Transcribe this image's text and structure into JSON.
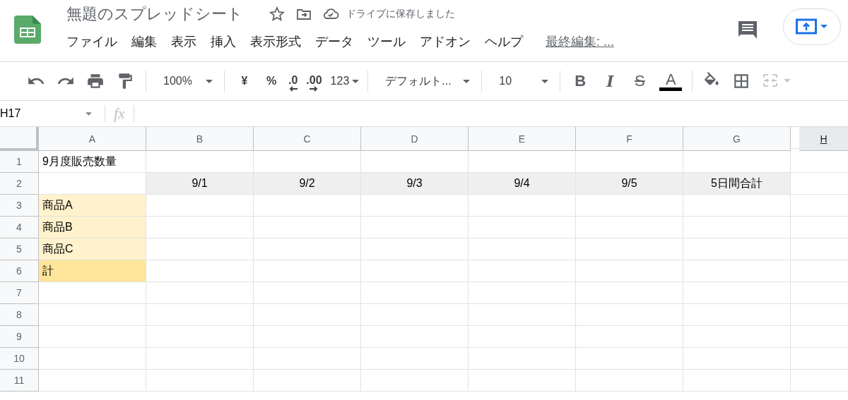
{
  "document": {
    "title": "無題のスプレッドシート",
    "save_status": "ドライブに保存しました",
    "starred": false
  },
  "menu": [
    "ファイル",
    "編集",
    "表示",
    "挿入",
    "表示形式",
    "データ",
    "ツール",
    "アドオン",
    "ヘルプ"
  ],
  "last_edit": "最終編集: ...",
  "toolbar": [
    {
      "kind": "undo"
    },
    {
      "kind": "redo"
    },
    {
      "kind": "print"
    },
    {
      "kind": "paint-format"
    },
    {
      "kind": "divider"
    },
    {
      "kind": "dropdown",
      "text": "100%"
    },
    {
      "kind": "divider"
    },
    {
      "kind": "text",
      "text": "¥"
    },
    {
      "kind": "text",
      "text": "%"
    },
    {
      "kind": "decimal-less",
      "text": ".0"
    },
    {
      "kind": "decimal-more",
      "text": ".00"
    },
    {
      "kind": "number-format",
      "text": "123"
    },
    {
      "kind": "divider"
    },
    {
      "kind": "font",
      "text": "デフォルト..."
    },
    {
      "kind": "divider"
    },
    {
      "kind": "dropdown",
      "text": "10"
    },
    {
      "kind": "divider"
    },
    {
      "kind": "bold",
      "text": "B"
    },
    {
      "kind": "italic",
      "text": "I"
    },
    {
      "kind": "strike",
      "text": "S"
    },
    {
      "kind": "text-color",
      "text": "A"
    },
    {
      "kind": "divider"
    },
    {
      "kind": "fill"
    },
    {
      "kind": "borders"
    },
    {
      "kind": "merge",
      "disabled": true
    }
  ],
  "name_box": "H17",
  "formula_label": "fx",
  "columns": [
    {
      "label": "A",
      "selected": false
    },
    {
      "label": "B",
      "selected": false
    },
    {
      "label": "C",
      "selected": false
    },
    {
      "label": "D",
      "selected": false
    },
    {
      "label": "E",
      "selected": false
    },
    {
      "label": "F",
      "selected": false
    },
    {
      "label": "G",
      "selected": false
    },
    {
      "label": "H",
      "selected": true
    }
  ],
  "rows": [
    {
      "label": "1",
      "cells": [
        {
          "text": "9月度販売数量"
        }
      ]
    },
    {
      "label": "2",
      "cells": [
        {},
        {
          "text": "9/1",
          "color": "#efefef"
        },
        {
          "text": "9/2",
          "color": "#efefef"
        },
        {
          "text": "9/3",
          "color": "#efefef"
        },
        {
          "text": "9/4",
          "color": "#efefef"
        },
        {
          "text": "9/5",
          "color": "#efefef"
        },
        {
          "text": "5日間合計",
          "color": "#efefef"
        }
      ]
    },
    {
      "label": "3",
      "cells": [
        {
          "text": "商品A",
          "color": "#fff2cc"
        }
      ]
    },
    {
      "label": "4",
      "cells": [
        {
          "text": "商品B",
          "color": "#fff2cc"
        }
      ]
    },
    {
      "label": "5",
      "cells": [
        {
          "text": "商品C",
          "color": "#fff2cc"
        }
      ]
    },
    {
      "label": "6",
      "cells": [
        {
          "text": "計",
          "color": "#ffe599"
        }
      ]
    },
    {
      "label": "7",
      "cells": []
    },
    {
      "label": "8",
      "cells": []
    },
    {
      "label": "9",
      "cells": []
    },
    {
      "label": "10",
      "cells": []
    },
    {
      "label": "11",
      "cells": []
    }
  ]
}
